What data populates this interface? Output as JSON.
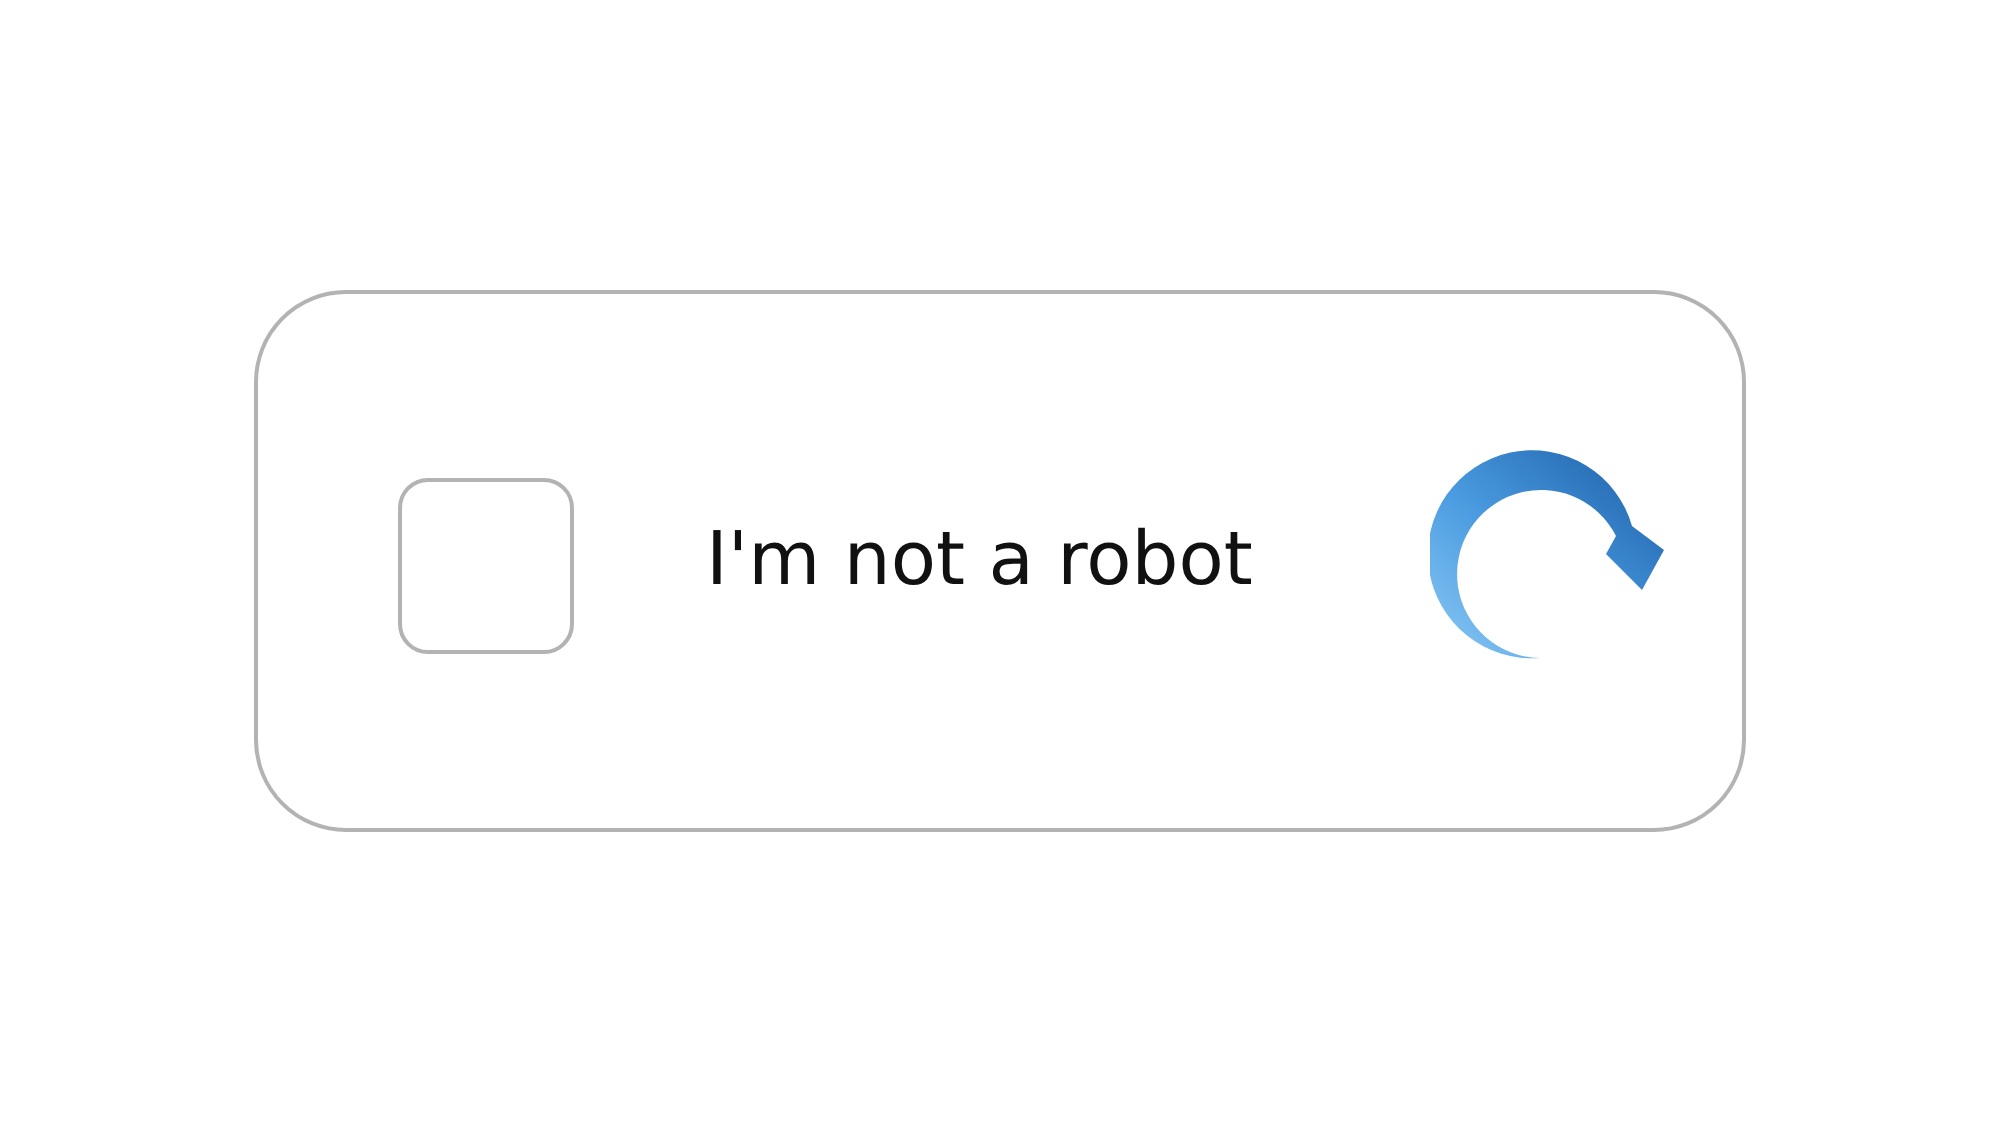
{
  "checkbox": {
    "checked": false
  },
  "label": "I'm not a robot"
}
